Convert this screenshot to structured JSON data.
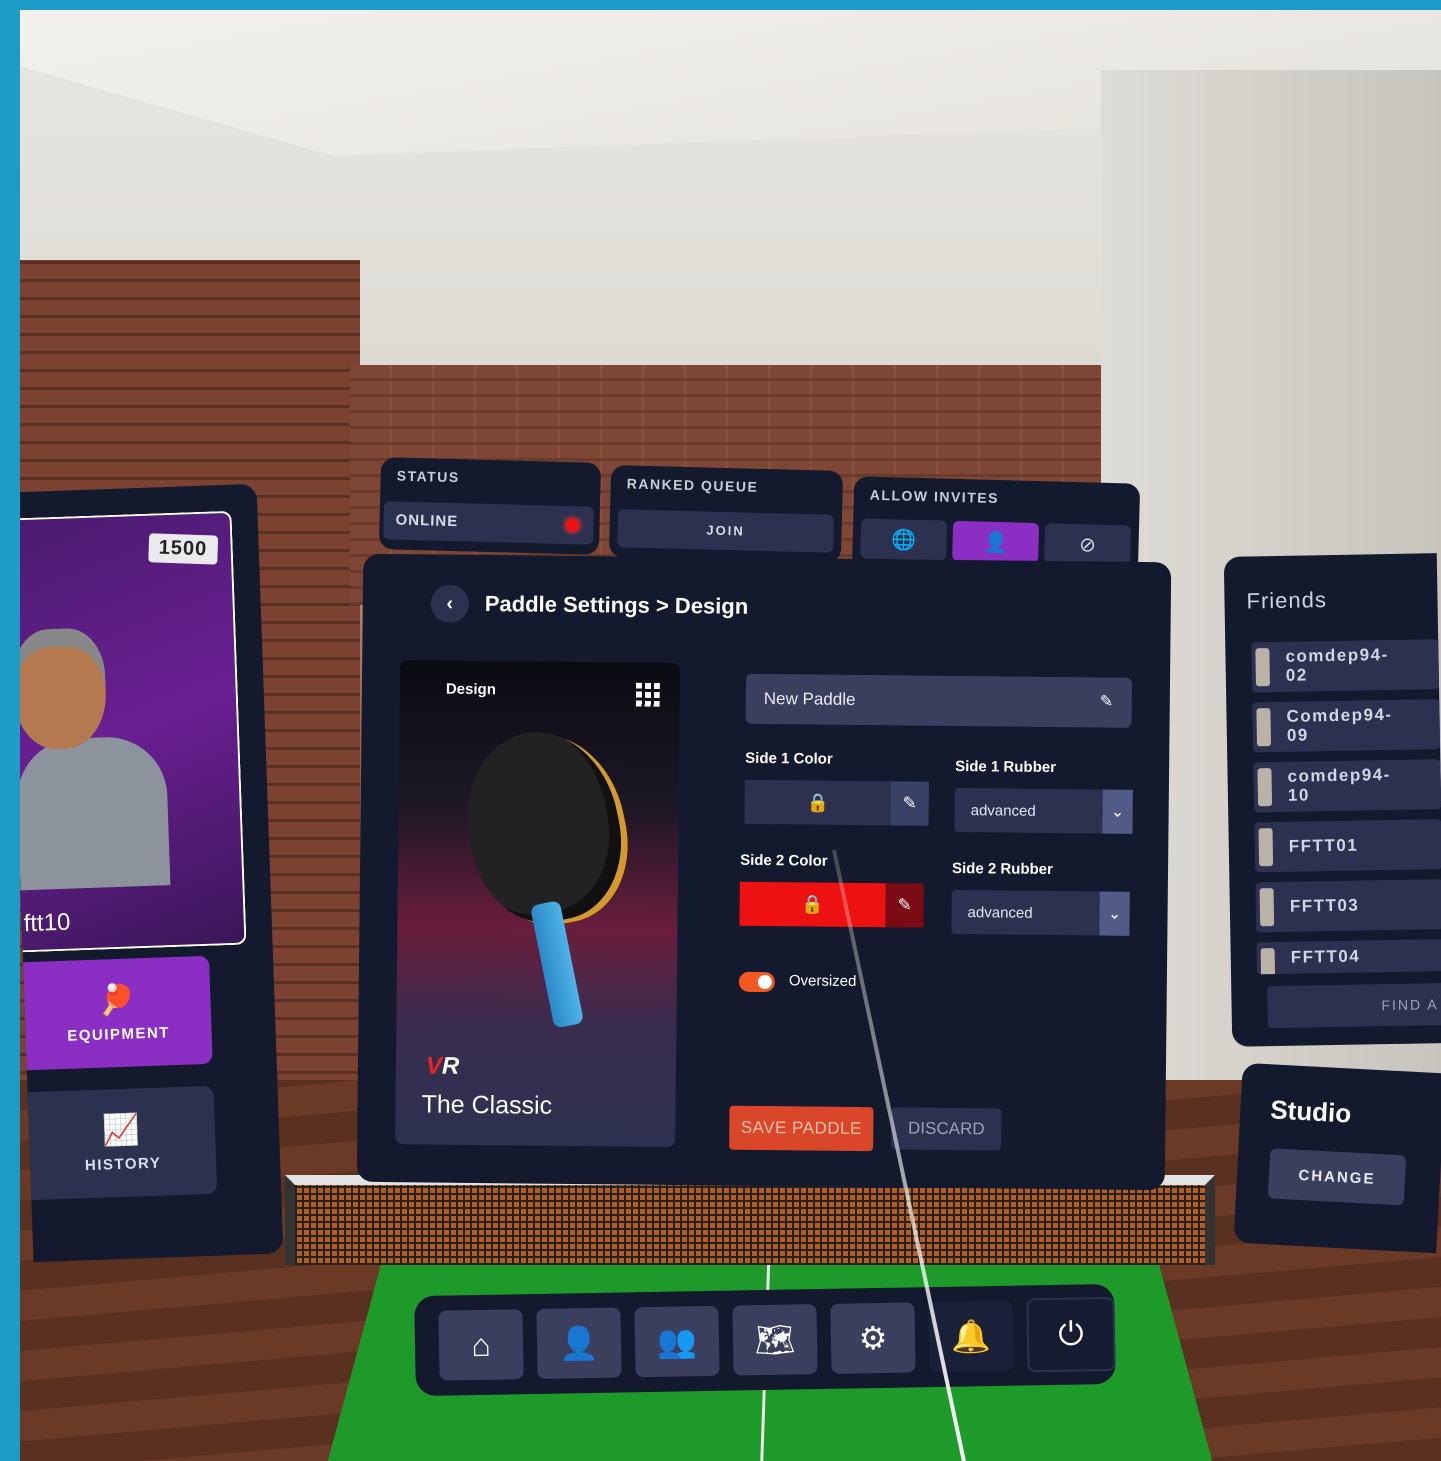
{
  "status": {
    "title": "STATUS",
    "value": "ONLINE",
    "indicator_color": "#e11111"
  },
  "ranked_queue": {
    "title": "RANKED QUEUE",
    "join_label": "JOIN"
  },
  "allow_invites": {
    "title": "ALLOW INVITES",
    "options": [
      {
        "icon": "globe-icon",
        "glyph": "🌐",
        "selected": false
      },
      {
        "icon": "friends-icon",
        "glyph": "👤",
        "selected": true
      },
      {
        "icon": "blocked-icon",
        "glyph": "⊘",
        "selected": false
      }
    ],
    "selected_color": "#8b2fc4"
  },
  "main": {
    "back_glyph": "‹",
    "breadcrumb": "Paddle Settings > Design",
    "preview": {
      "label": "Design",
      "brand_left": "V",
      "brand_right": "R",
      "paddle_name": "The Classic"
    },
    "paddle_name_field": "New Paddle",
    "pencil_glyph": "✎",
    "side1_color_label": "Side 1 Color",
    "side1_color": "#2c3150",
    "side1_rubber_label": "Side 1 Rubber",
    "side1_rubber": "advanced",
    "side2_color_label": "Side 2 Color",
    "side2_color": "#ee1111",
    "side2_rubber_label": "Side 2 Rubber",
    "side2_rubber": "advanced",
    "lock_glyph": "🔒",
    "caret_glyph": "⌄",
    "oversized_label": "Oversized",
    "oversized_on": true,
    "save_label": "SAVE PADDLE",
    "discard_label": "DISCARD"
  },
  "profile": {
    "rating": "1500",
    "name": "ftt10",
    "equipment_label": "EQUIPMENT",
    "equipment_glyph": "🏓",
    "history_label": "HISTORY",
    "history_glyph": "📈"
  },
  "friends": {
    "title": "Friends",
    "items": [
      "comdep94-\n02",
      "Comdep94-\n09",
      "comdep94-\n10",
      "FFTT01",
      "FFTT03",
      "FFTT04"
    ],
    "find_label": "FIND A"
  },
  "studio": {
    "title": "Studio",
    "change_label": "CHANGE"
  },
  "dock": [
    {
      "icon": "home-icon",
      "glyph": "⌂"
    },
    {
      "icon": "profile-icon",
      "glyph": "👤"
    },
    {
      "icon": "friends-icon",
      "glyph": "👥"
    },
    {
      "icon": "map-icon",
      "glyph": "🗺"
    },
    {
      "icon": "settings-icon",
      "glyph": "⚙"
    },
    {
      "icon": "bell-icon",
      "glyph": "🔔"
    },
    {
      "icon": "power-icon",
      "glyph": "⏻"
    }
  ]
}
